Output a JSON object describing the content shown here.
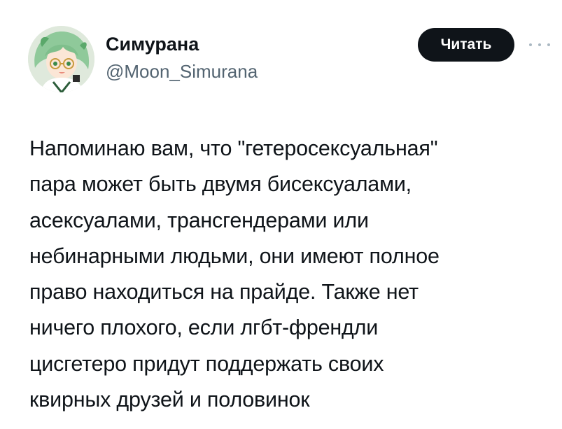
{
  "author": {
    "display_name": "Симурана",
    "handle": "@Moon_Simurana",
    "avatar_icon": "anime-character-avatar-icon"
  },
  "actions": {
    "follow_label": "Читать",
    "more_icon": "more-dots-icon"
  },
  "tweet": {
    "lines": [
      "Напоминаю вам, что \"гетеросексуальная\"",
      "пара может быть двумя бисексуалами,",
      "асексуалами, трансгендерами или",
      "небинарными людьми, они имеют полное",
      "право находиться на прайде. Также нет",
      "ничего плохого, если лгбт-френдли",
      "цисгетеро придут поддержать своих",
      "квирных друзей и половинок"
    ]
  },
  "colors": {
    "text": "#0f1419",
    "secondary_text": "#536471",
    "button_bg": "#0f1419",
    "button_text": "#ffffff"
  }
}
